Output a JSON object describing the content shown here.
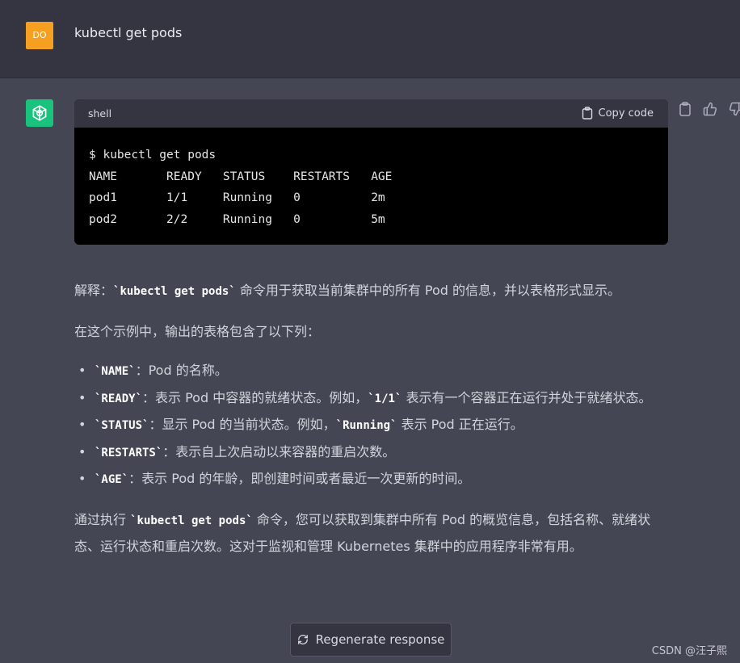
{
  "user_message": {
    "avatar_text": "DO",
    "text": "kubectl get pods"
  },
  "assistant_message": {
    "code_block": {
      "language": "shell",
      "copy_label": "Copy code",
      "lines": [
        "$ kubectl get pods",
        "NAME       READY   STATUS    RESTARTS   AGE",
        "pod1       1/1     Running   0          2m",
        "pod2       2/2     Running   0          5m"
      ]
    },
    "paragraph1": {
      "prefix": "解释：",
      "code": "`kubectl get pods`",
      "suffix": " 命令用于获取当前集群中的所有 Pod 的信息，并以表格形式显示。"
    },
    "paragraph2": "在这个示例中，输出的表格包含了以下列：",
    "bullets": [
      {
        "code": "`NAME`",
        "text": "：Pod 的名称。"
      },
      {
        "code": "`READY`",
        "text": "：表示 Pod 中容器的就绪状态。例如，",
        "code2": "`1/1`",
        "text2": " 表示有一个容器正在运行并处于就绪状态。"
      },
      {
        "code": "`STATUS`",
        "text": "：显示 Pod 的当前状态。例如，",
        "code2": "`Running`",
        "text2": " 表示 Pod 正在运行。"
      },
      {
        "code": "`RESTARTS`",
        "text": "：表示自上次启动以来容器的重启次数。"
      },
      {
        "code": "`AGE`",
        "text": "：表示 Pod 的年龄，即创建时间或者最近一次更新的时间。"
      }
    ],
    "paragraph3": {
      "prefix": "通过执行 ",
      "code": "`kubectl get pods`",
      "suffix": " 命令，您可以获取到集群中所有 Pod 的概览信息，包括名称、就绪状态、运行状态和重启次数。这对于监视和管理 Kubernetes 集群中的应用程序非常有用。"
    }
  },
  "regenerate_label": "Regenerate response",
  "watermark": "CSDN @汪子熙",
  "colors": {
    "user_avatar": "#f5a020",
    "bot_avatar": "#19c37d",
    "page_bg": "#444654",
    "user_row_bg": "#343541"
  },
  "icons": [
    "openai-logo-icon",
    "clipboard-icon",
    "thumbs-up-icon",
    "thumbs-down-icon",
    "refresh-icon"
  ]
}
